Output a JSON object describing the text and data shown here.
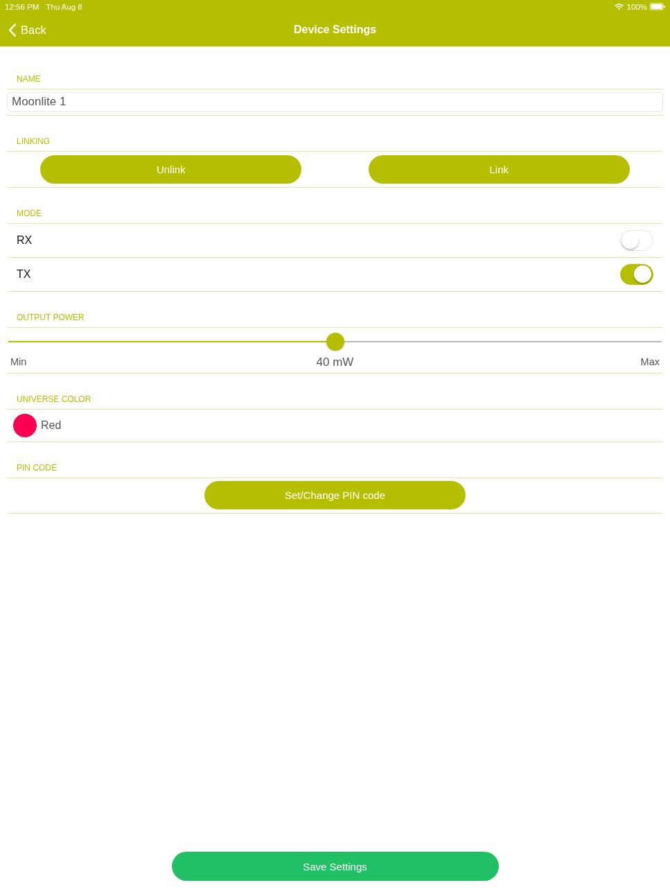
{
  "status_bar": {
    "time": "12:56 PM",
    "date": "Thu Aug 8",
    "battery": "100%"
  },
  "nav_bar": {
    "back": "Back",
    "title": "Device Settings"
  },
  "sections": [
    {
      "kind": "field",
      "title": "NAME",
      "value": "Moonlite 1"
    },
    {
      "kind": "buttons",
      "title": "LINKING",
      "buttons": [
        "Unlink",
        "Link"
      ]
    },
    {
      "kind": "toggles",
      "title": "MODE",
      "rows": [
        {
          "label": "RX",
          "on": false
        },
        {
          "label": "TX",
          "on": true
        }
      ]
    },
    {
      "kind": "slider",
      "title": "OUTPUT POWER",
      "min_label": "Min",
      "reading": "40 mW",
      "max_label": "Max",
      "level": 0.5
    },
    {
      "kind": "color",
      "title": "UNIVERSE COLOR",
      "color_name": "Red",
      "color": "#fb0052"
    },
    {
      "kind": "button",
      "title": "PIN CODE",
      "button": "Set/Change PIN code"
    }
  ],
  "save_button": "Save Settings"
}
